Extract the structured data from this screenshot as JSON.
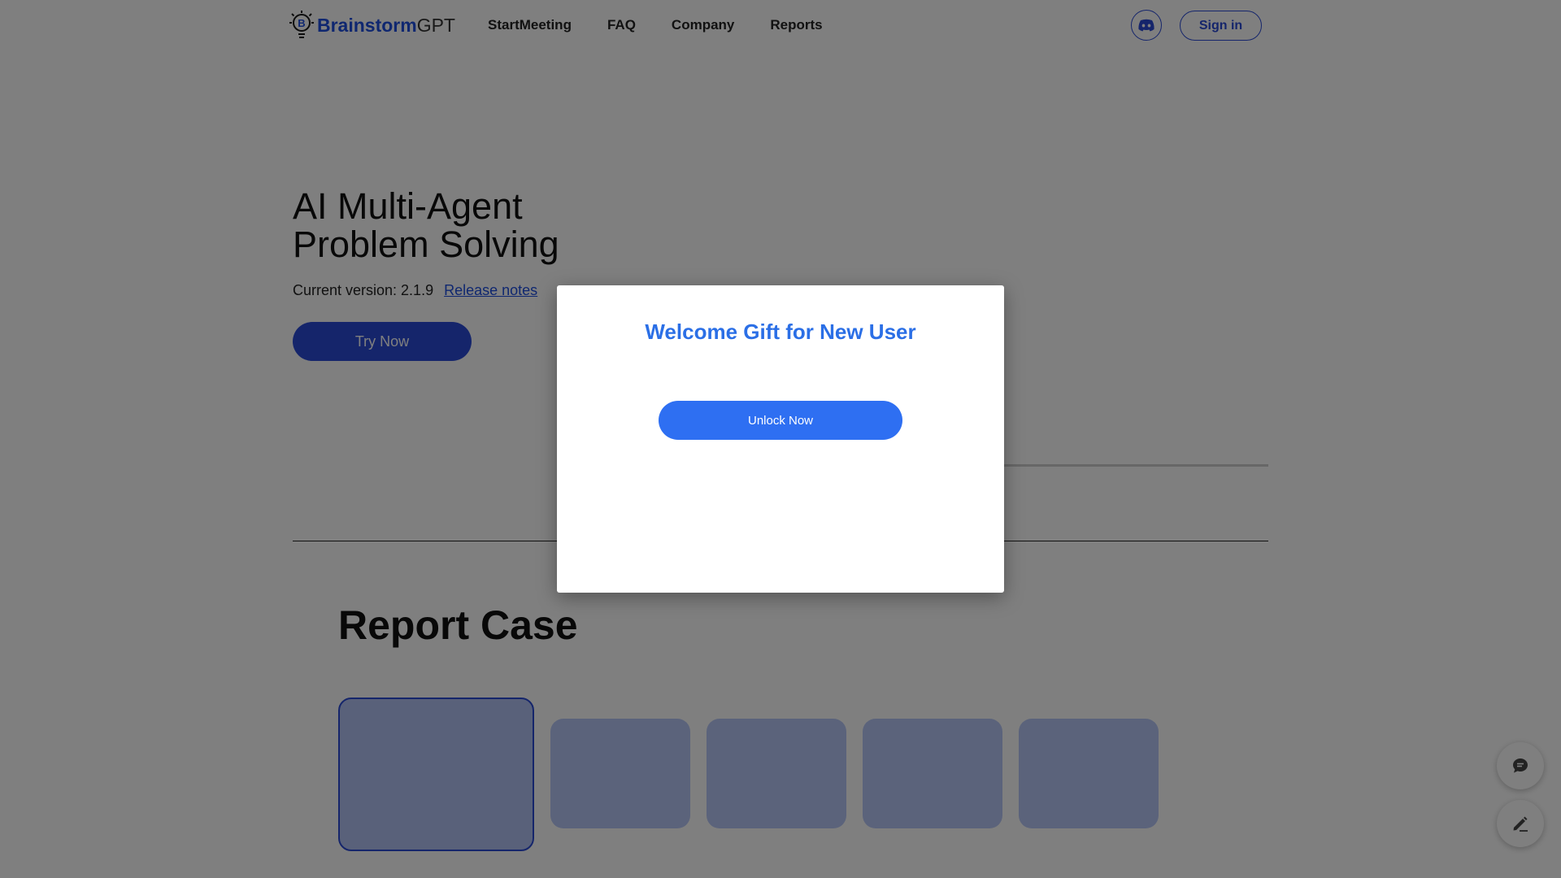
{
  "header": {
    "logo_brand": "Brainstorm",
    "logo_suffix": "GPT",
    "nav": [
      {
        "label": "StartMeeting"
      },
      {
        "label": "FAQ"
      },
      {
        "label": "Company"
      },
      {
        "label": "Reports"
      }
    ],
    "discord_icon": "discord-icon",
    "signin_label": "Sign in"
  },
  "hero": {
    "title_line1": "AI Multi-Agent",
    "title_line2": "Problem Solving",
    "version_text": "Current version: 2.1.9",
    "release_notes_label": "Release notes",
    "try_label": "Try Now"
  },
  "report": {
    "title": "Report Case",
    "card_count": 5
  },
  "floating": {
    "chat_icon": "chat-icon",
    "edit_icon": "edit-icon"
  },
  "modal": {
    "title": "Welcome Gift for New User",
    "unlock_label": "Unlock Now"
  },
  "colors": {
    "brand_blue": "#2a4bd7",
    "modal_blue": "#2e6ff2",
    "card_fill": "#b7c7f7",
    "overlay": "rgba(0,0,0,0.5)"
  }
}
